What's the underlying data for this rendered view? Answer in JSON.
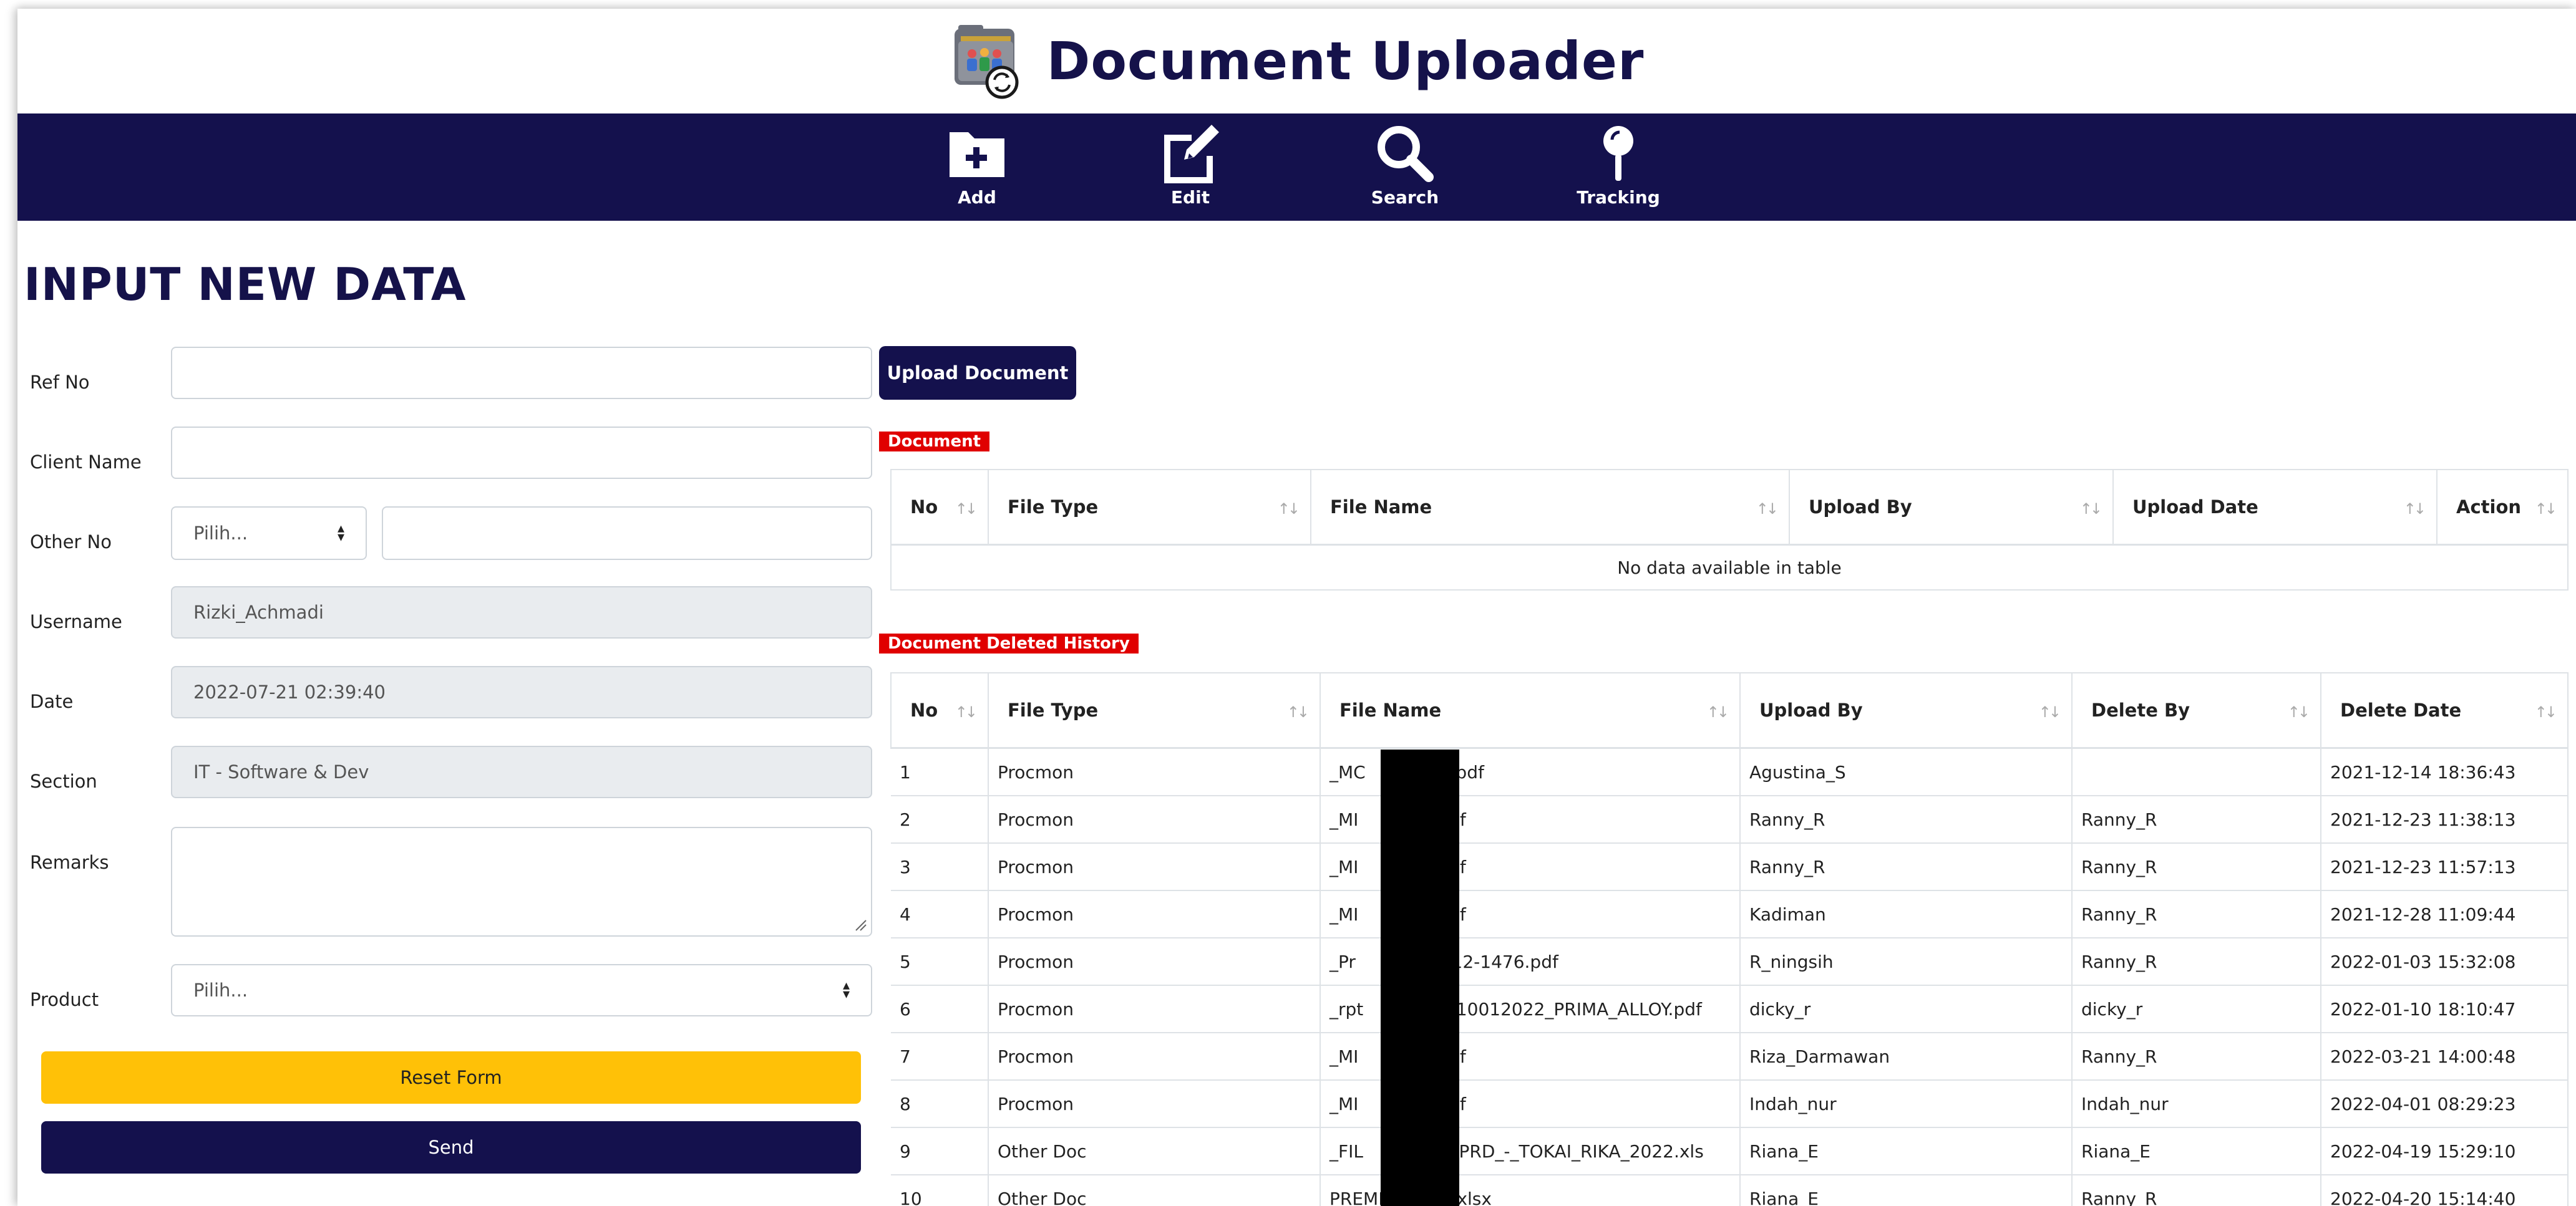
{
  "app": {
    "title": "Document Uploader",
    "logo_icon": "document-people-sync-icon"
  },
  "navbar": {
    "items": [
      {
        "label": "Add",
        "icon": "folder-plus-icon"
      },
      {
        "label": "Edit",
        "icon": "edit-icon"
      },
      {
        "label": "Search",
        "icon": "search-icon"
      },
      {
        "label": "Tracking",
        "icon": "map-pin-icon"
      }
    ]
  },
  "form": {
    "heading": "INPUT NEW DATA",
    "ref_no": {
      "label": "Ref No",
      "value": ""
    },
    "client_name": {
      "label": "Client Name",
      "value": ""
    },
    "other_no": {
      "label": "Other No",
      "select_value": "Pilih...",
      "value": ""
    },
    "username": {
      "label": "Username",
      "value": "Rizki_Achmadi"
    },
    "date": {
      "label": "Date",
      "value": "2022-07-21 02:39:40"
    },
    "section": {
      "label": "Section",
      "value": "IT - Software & Dev"
    },
    "remarks": {
      "label": "Remarks",
      "value": ""
    },
    "product": {
      "label": "Product",
      "select_value": "Pilih..."
    },
    "reset_label": "Reset Form",
    "send_label": "Send"
  },
  "upload": {
    "button_label": "Upload Document"
  },
  "documents": {
    "tag": "Document",
    "columns": [
      "No",
      "File Type",
      "File Name",
      "Upload By",
      "Upload Date",
      "Action"
    ],
    "empty_text": "No data available in table"
  },
  "deleted_history": {
    "tag": "Document Deleted History",
    "columns": [
      "No",
      "File Type",
      "File Name",
      "Upload By",
      "Delete By",
      "Delete Date"
    ],
    "rows": [
      {
        "no": "1",
        "type": "Procmon",
        "name": "_MC",
        "name_tail": "3.pdf",
        "upload_by": "Agustina_S",
        "delete_by": "",
        "date": "2021-12-14 18:36:43"
      },
      {
        "no": "2",
        "type": "Procmon",
        "name": "_MI",
        "name_tail": ".pdf",
        "upload_by": "Ranny_R",
        "delete_by": "Ranny_R",
        "date": "2021-12-23 11:38:13"
      },
      {
        "no": "3",
        "type": "Procmon",
        "name": "_MI",
        "name_tail": ".pdf",
        "upload_by": "Ranny_R",
        "delete_by": "Ranny_R",
        "date": "2021-12-23 11:57:13"
      },
      {
        "no": "4",
        "type": "Procmon",
        "name": "_MI",
        "name_tail": ".pdf",
        "upload_by": "Kadiman",
        "delete_by": "Ranny_R",
        "date": "2021-12-28 11:09:44"
      },
      {
        "no": "5",
        "type": "Procmon",
        "name": "_Pr",
        "name_tail": "2112-1476.pdf",
        "upload_by": "R_ningsih",
        "delete_by": "Ranny_R",
        "date": "2022-01-03 15:32:08"
      },
      {
        "no": "6",
        "type": "Procmon",
        "name": "_rpt",
        "name_tail": "y_10012022_PRIMA_ALLOY.pdf",
        "upload_by": "dicky_r",
        "delete_by": "dicky_r",
        "date": "2022-01-10 18:10:47"
      },
      {
        "no": "7",
        "type": "Procmon",
        "name": "_MI",
        "name_tail": ".pdf",
        "upload_by": "Riza_Darmawan",
        "delete_by": "Ranny_R",
        "date": "2022-03-21 14:00:48"
      },
      {
        "no": "8",
        "type": "Procmon",
        "name": "_MI",
        "name_tail": ".pdf",
        "upload_by": "Indah_nur",
        "delete_by": "Indah_nur",
        "date": "2022-04-01 08:29:23"
      },
      {
        "no": "9",
        "type": "Other Doc",
        "name": "_FIL",
        "name_tail": "D_PRD_-_TOKAI_RIKA_2022.xls",
        "upload_by": "Riana_E",
        "delete_by": "Riana_E",
        "date": "2022-04-19 15:29:10"
      },
      {
        "no": "10",
        "type": "Other Doc",
        "name": "PREMI",
        "name_tail": "xlsx",
        "upload_by": "Riana_E",
        "delete_by": "Ranny_R",
        "date": "2022-04-20 15:14:40"
      }
    ]
  },
  "colors": {
    "navy": "#14114d",
    "yellow": "#ffc107",
    "red_tag": "#e00000"
  }
}
